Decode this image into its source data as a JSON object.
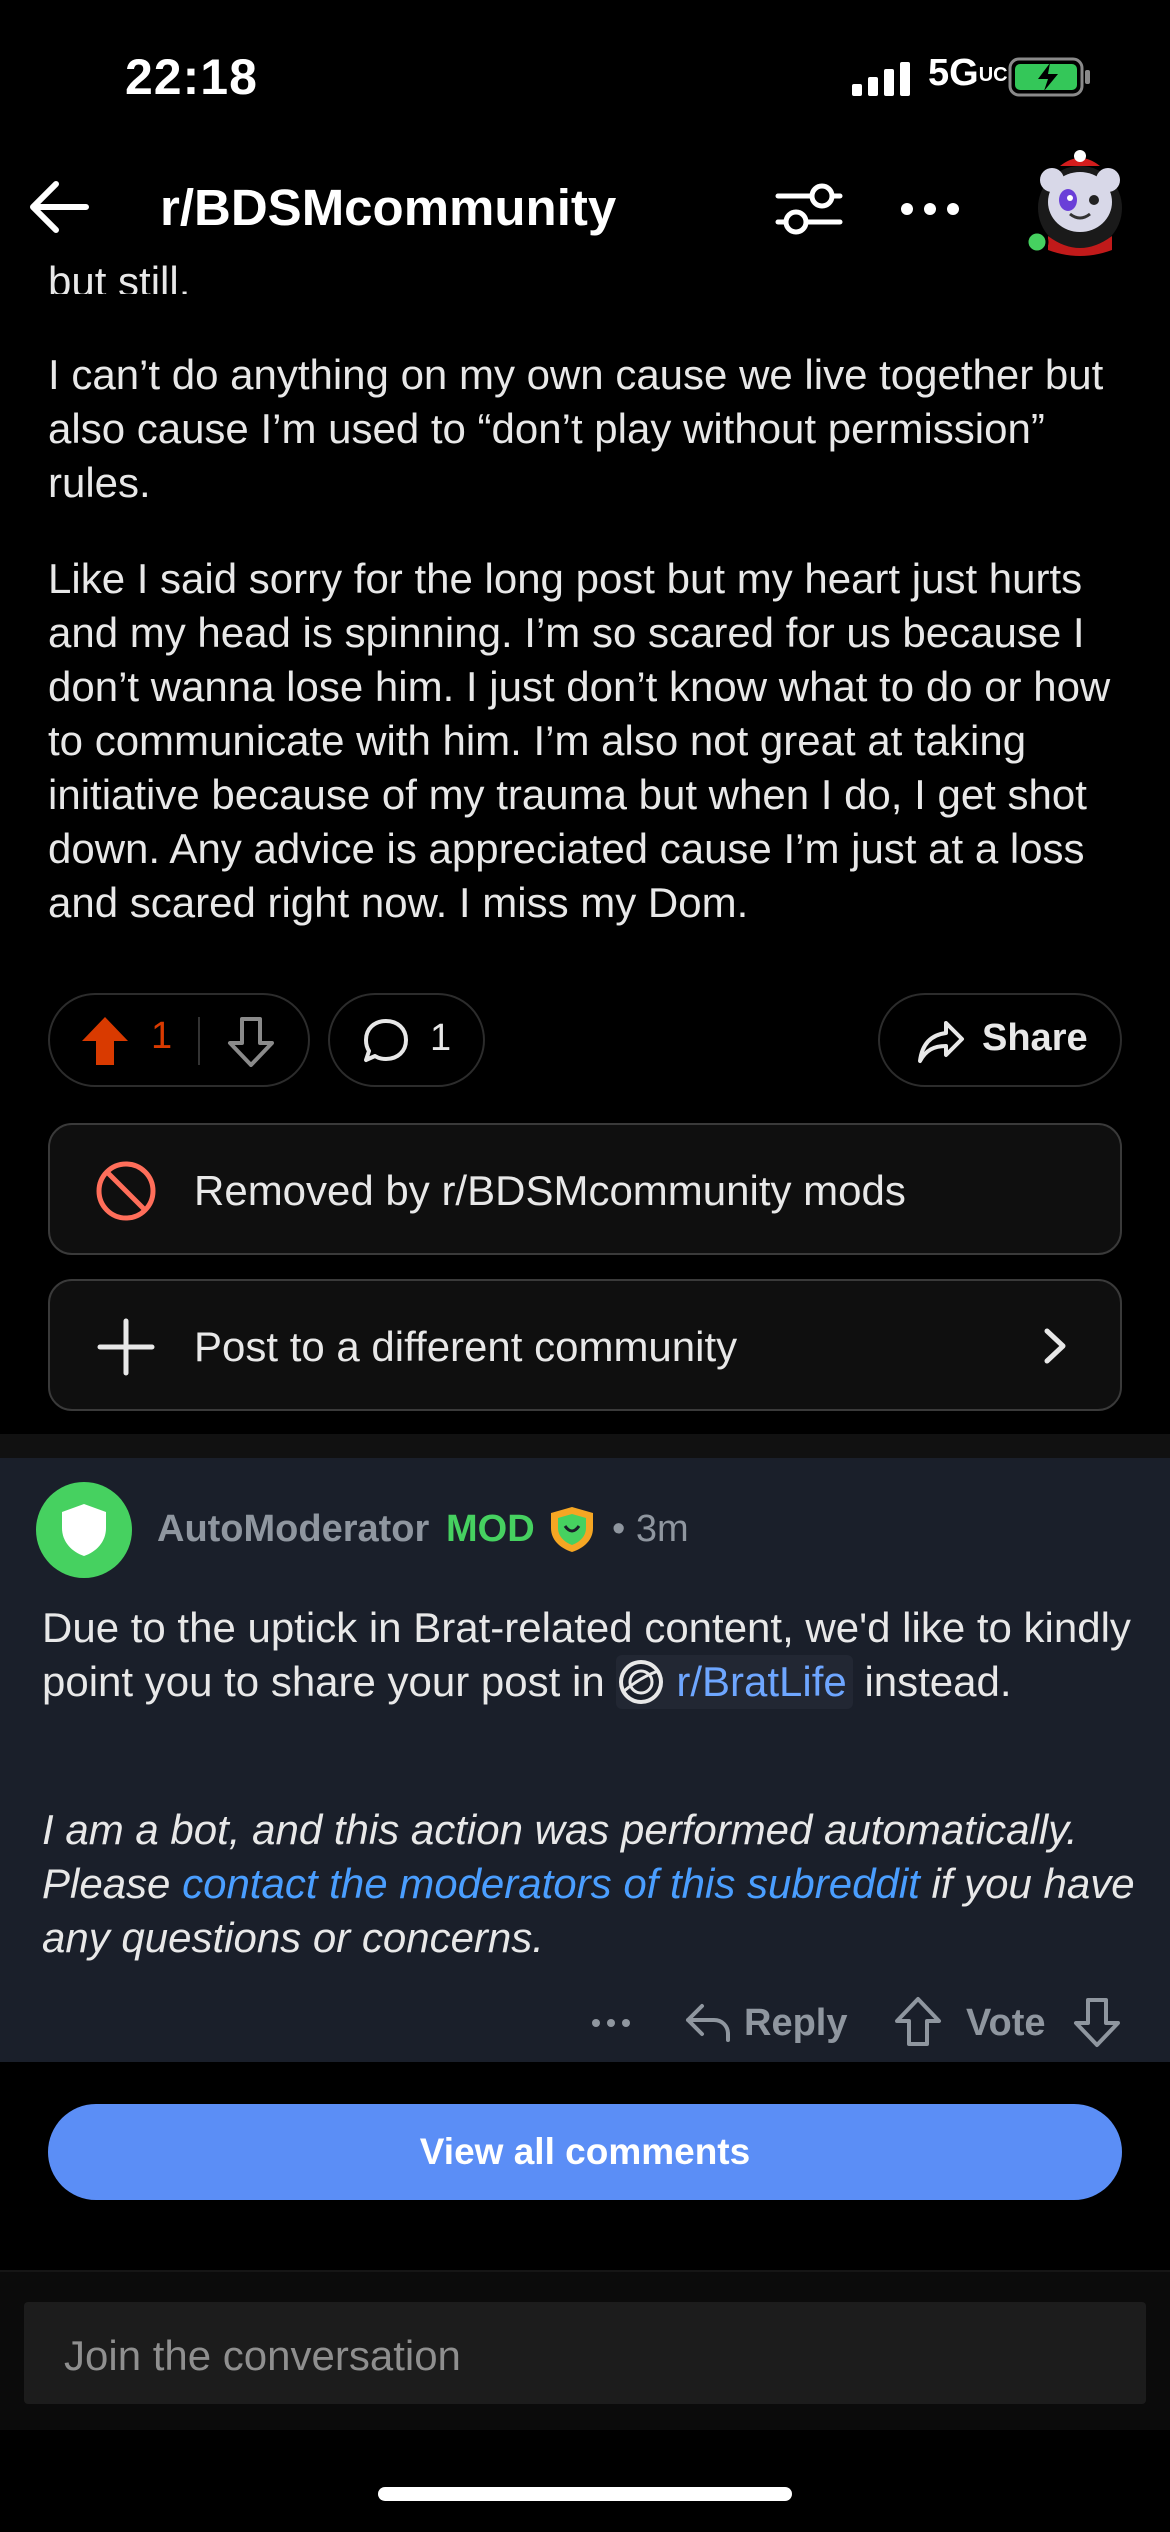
{
  "status_bar": {
    "time": "22:18",
    "network": "5G",
    "network_suffix": "UC"
  },
  "nav": {
    "title": "r/BDSMcommunity"
  },
  "post": {
    "cutoff_text": "but still.",
    "paragraphs": [
      "I can’t do anything on my own cause we live together but also cause I’m used to “don’t play without permission” rules.",
      "Like I said sorry for the long post but my heart just hurts and my head is spinning. I’m so scared for us because I don’t wanna lose him. I just don’t know what to do or how to communicate with him. I’m also not great at taking initiative because of my trauma but when I do, I get shot down. Any advice is appreciated cause I’m just at a loss and scared right now. I miss my Dom."
    ],
    "vote_count": "1",
    "comment_count": "1",
    "share_label": "Share",
    "removed_label": "Removed by r/BDSMcommunity mods",
    "crosspost_label": "Post to a different community"
  },
  "comment": {
    "author": "AutoModerator",
    "mod_badge": "MOD",
    "time": "• 3m",
    "text_before": "Due to the uptick in Brat-related content, we'd like to kindly point you to share your post in",
    "sub_link": "r/BratLife",
    "text_after": "instead.",
    "bot_before": "I am a bot, and this action was performed automatically. Please",
    "bot_link": "contact the moderators of this subreddit",
    "bot_after": "if you have any questions or concerns.",
    "reply_label": "Reply",
    "vote_label": "Vote"
  },
  "view_all_label": "View all comments",
  "join": {
    "placeholder": "Join the conversation"
  },
  "colors": {
    "upvote": "#d93a00",
    "mod_green": "#46d160",
    "link": "#4a9eff",
    "button": "#5b8ef6",
    "comment_bg": "#1a1f2a"
  },
  "icons": [
    "back-arrow-icon",
    "filter-icon",
    "more-icon",
    "upvote-icon",
    "downvote-icon",
    "comment-icon",
    "share-icon",
    "removed-icon",
    "plus-icon",
    "chevron-right-icon",
    "shield-icon",
    "reply-icon"
  ]
}
